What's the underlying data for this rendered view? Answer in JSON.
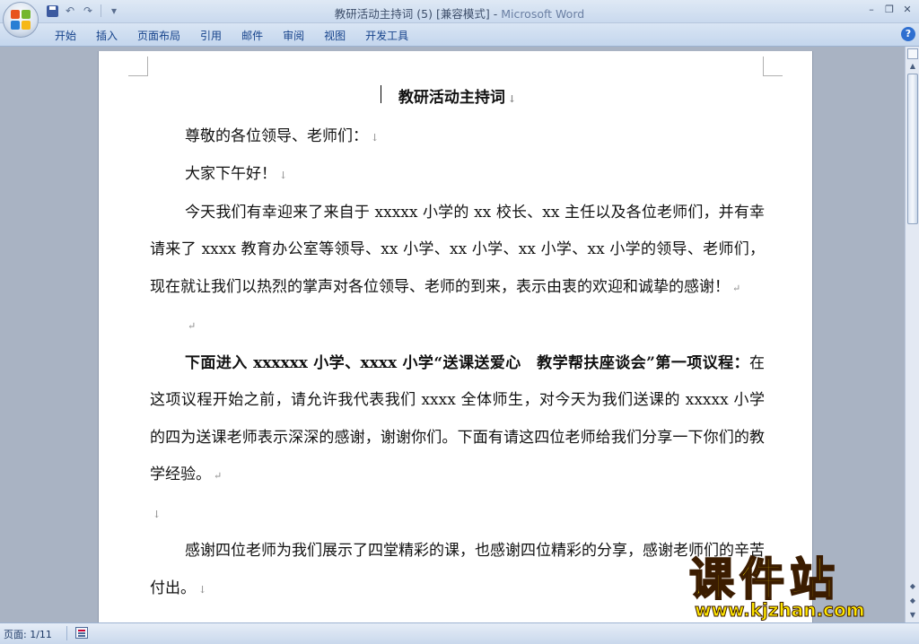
{
  "window": {
    "title_doc": "教研活动主持词 (5) [兼容模式]",
    "title_sep": " - ",
    "title_app": "Microsoft Word",
    "minimize": "–",
    "restore": "❐",
    "close": "✕"
  },
  "qat": {
    "undo": "↶",
    "redo": "↷",
    "customize": "▾"
  },
  "ribbon": {
    "tabs": [
      "开始",
      "插入",
      "页面布局",
      "引用",
      "邮件",
      "审阅",
      "视图",
      "开发工具"
    ],
    "help": "?"
  },
  "document": {
    "title": "教研活动主持词",
    "para1": "尊敬的各位领导、老师们：",
    "para2": "大家下午好！",
    "para3": "今天我们有幸迎来了来自于 xxxxx 小学的 xx 校长、xx 主任以及各位老师们，并有幸请来了 xxxx 教育办公室等领导、xx 小学、xx 小学、xx 小学、xx 小学的领导、老师们，现在就让我们以热烈的掌声对各位领导、老师的到来，表示由衷的欢迎和诚挚的感谢！",
    "para5_bold": "下面进入 xxxxxx 小学、xxxx 小学“送课送爱心　教学帮扶座谈会”第一项议程：",
    "para5_rest": "在这项议程开始之前，请允许我代表我们 xxxx 全体师生，对今天为我们送课的 xxxxx 小学的四为送课老师表示深深的感谢，谢谢你们。下面有请这四位老师给我们分享一下你们的教学经验。",
    "para7": "感谢四位老师为我们展示了四堂精彩的课，也感谢四位精彩的分享，感谢老师们的辛苦付出。",
    "mark_down": "↓",
    "mark_return": "↵"
  },
  "statusbar": {
    "page": "页面: 1/11"
  },
  "watermark": {
    "name": "课件站",
    "url": "www.kjzhan.com"
  },
  "scrollbar": {
    "up": "▲",
    "down": "▼",
    "prev": "◆",
    "next": "▼"
  }
}
